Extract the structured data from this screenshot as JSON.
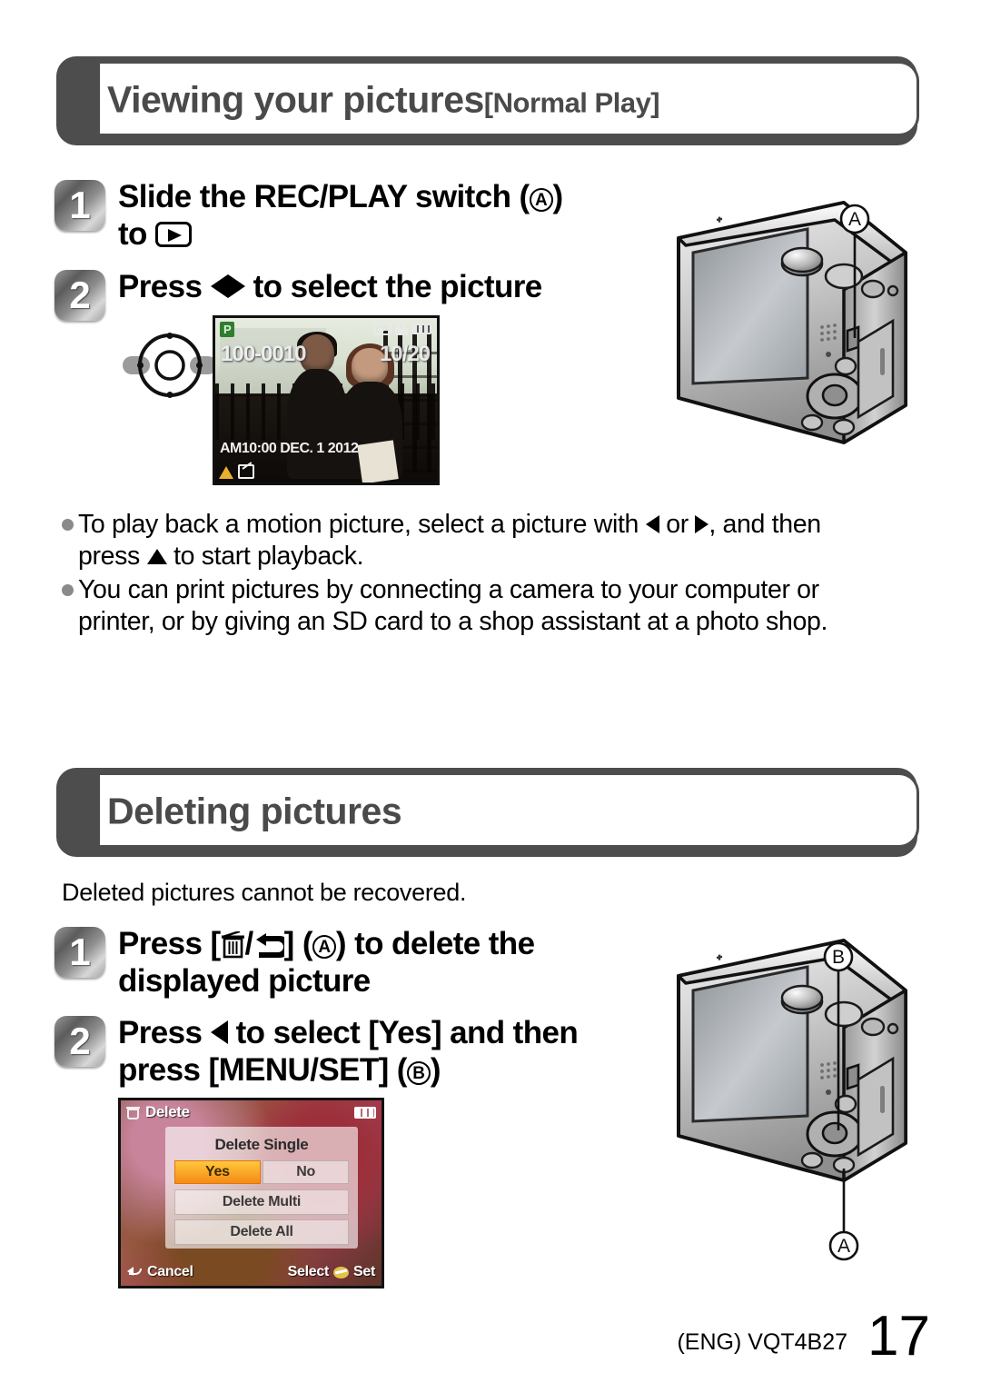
{
  "page": {
    "number": "17",
    "manual_code": "(ENG) VQT4B27"
  },
  "sections": [
    {
      "id": "viewing",
      "title": "Viewing your pictures",
      "subtitle": "[Normal Play]"
    },
    {
      "id": "deleting",
      "title": "Deleting pictures",
      "subtitle": ""
    }
  ],
  "viewing_steps": {
    "step1": {
      "number": "1",
      "line1_a": "Slide the REC/PLAY switch (",
      "circle_a": "A",
      "line1_b": ")",
      "line2_a": "to",
      "play_icon": "play-icon"
    },
    "step2": {
      "number": "2",
      "text_a": "Press",
      "left_icon": "left-arrow-icon",
      "right_icon": "right-arrow-icon",
      "text_b": "to select the picture"
    }
  },
  "deleting_intro": "Deleted pictures cannot be recovered.",
  "deleting_steps": {
    "step1": {
      "number": "1",
      "text_a": "Press [",
      "trash_icon": "trash-icon",
      "slash": "/",
      "return_icon": "return-icon",
      "text_b": "] (",
      "circle_a": "A",
      "text_c": ") to delete the",
      "line2": "displayed picture"
    },
    "step2": {
      "number": "2",
      "text_a": "Press",
      "left_icon": "left-arrow-icon",
      "text_b": "to select [Yes] and then",
      "line2_a": "press [MENU/SET] (",
      "circle_b": "B",
      "line2_b": ")"
    }
  },
  "notes": [
    {
      "part1": "To play back a motion picture, select a picture with",
      "icon1": "left-arrow-icon",
      "mid": "or",
      "icon2": "right-arrow-icon",
      "part2": ", and then",
      "line2_a": "press",
      "icon3": "up-arrow-icon",
      "line2_b": "to start playback."
    },
    {
      "part1": "You can print pictures by connecting a camera to your computer or",
      "line2": "printer, or by giving an SD card to a shop assistant at a photo shop."
    }
  ],
  "lcd_photo": {
    "mode_badge": "P",
    "file_number": "100-0010",
    "frame_counter": "10/20",
    "datetime": "AM10:00 DEC. 1 2012",
    "icons": {
      "playback": "playback-icon",
      "lock": "lock-icon",
      "battery": "battery-icon",
      "warning": "warning-icon",
      "edit": "edit-icon"
    }
  },
  "lcd_delete": {
    "title": "Delete",
    "trash_icon": "trash-icon",
    "battery_icon": "battery-icon",
    "heading": "Delete Single",
    "yes_label": "Yes",
    "no_label": "No",
    "selected": "Yes",
    "options": [
      "Delete Multi",
      "Delete All"
    ],
    "cancel_label": "Cancel",
    "set_label_prefix": "Select",
    "set_label_suffix": "Set",
    "highlight_color": "#f58a15"
  },
  "callouts": {
    "camera_top": [
      "A"
    ],
    "camera_bottom": [
      "B",
      "A"
    ]
  },
  "colors": {
    "banner_dark": "#4d4d4d",
    "banner_text": "#4a4a4a",
    "bullet_dot": "#8a8a8a",
    "body_text": "#000000"
  }
}
